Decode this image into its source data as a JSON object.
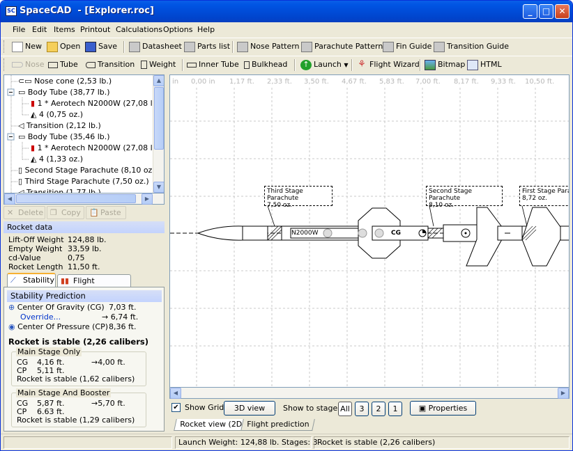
{
  "window": {
    "app": "SpaceCAD",
    "doc": "- [Explorer.roc]",
    "minimize": "_",
    "maximize": "□",
    "close": "✕"
  },
  "menu": [
    "File",
    "Edit",
    "Items",
    "Printout",
    "Calculations",
    "Options",
    "Help"
  ],
  "toolbar1": [
    "New",
    "Open",
    "Save",
    "Datasheet",
    "Parts list",
    "Nose Pattern",
    "Parachute Pattern",
    "Fin Guide",
    "Transition Guide"
  ],
  "toolbar2": [
    "Nose",
    "Tube",
    "Transition",
    "Weight",
    "Inner Tube",
    "Bulkhead",
    "Launch",
    "Flight Wizard",
    "Bitmap",
    "HTML"
  ],
  "tree": [
    "Nose cone (2,53 lb.)",
    "Body Tube (38,77 lb.)",
    "1 * Aerotech N2000W (27,08 lb",
    "4  (0,75 oz.)",
    "Transition (2,12 lb.)",
    "Body Tube (35,46 lb.)",
    "1 * Aerotech N2000W (27,08 lb",
    "4  (1,33 oz.)",
    "Second Stage Parachute (8,10 oz.)",
    "Third Stage Parachute (7,50 oz.)",
    "Transition (1,77 lb.)"
  ],
  "edit": {
    "delete": "Delete",
    "copy": "Copy",
    "paste": "Paste"
  },
  "rocket_data": {
    "header": "Rocket data",
    "rows": [
      {
        "label": "Lift-Off Weight",
        "value": "124,88 lb."
      },
      {
        "label": "Empty Weight",
        "value": "33,59 lb."
      },
      {
        "label": "cd-Value",
        "value": "0,75"
      },
      {
        "label": "Rocket Length",
        "value": "11,50 ft."
      }
    ]
  },
  "left_tabs": [
    "Stability",
    "Flight prediction"
  ],
  "stability": {
    "header": "Stability Prediction",
    "cg_label": "Center Of Gravity (CG)",
    "cg_value": "7,03 ft.",
    "override_label": "Override...",
    "override_value": "→ 6,74 ft.",
    "cp_label": "Center Of Pressure (CP)",
    "cp_value": "8,36 ft.",
    "verdict": "Rocket is stable (2,26 calibers)",
    "main_only": {
      "title": "Main Stage Only",
      "cg_label": "CG",
      "cg": "4,16 ft.",
      "cg_to": "→4,00 ft.",
      "cp_label": "CP",
      "cp": "5,11 ft.",
      "verdict": "Rocket is stable (1,62 calibers)"
    },
    "main_booster": {
      "title": "Main Stage And Booster",
      "cg_label": "CG",
      "cg": "5,87 ft.",
      "cg_to": "→5,70 ft.",
      "cp_label": "CP",
      "cp": "6.63 ft.",
      "verdict": "Rocket is stable (1,29 calibers)"
    }
  },
  "ruler": [
    "in",
    "0,00 in",
    "1,17 ft.",
    "2,33 ft.",
    "3,50 ft.",
    "4,67 ft.",
    "5,83 ft.",
    "7,00 ft.",
    "8,17 ft.",
    "9,33 ft.",
    "10,50 ft."
  ],
  "callouts": [
    {
      "title": "Third Stage Parachute",
      "value": "7,50 oz."
    },
    {
      "title": "Second Stage Parachute",
      "value": "8,10 oz."
    },
    {
      "title": "First Stage Para",
      "value": "8,72 oz."
    }
  ],
  "motor_label": "N2000W",
  "cg_marker": "CG",
  "bottom": {
    "show_grid": "Show Grid",
    "view3d": "3D view",
    "show_to_stage": "Show to stage:",
    "stages": [
      "All",
      "3",
      "2",
      "1"
    ],
    "properties": "Properties"
  },
  "view_tabs": [
    "Rocket view (2D)",
    "Flight prediction"
  ],
  "status": {
    "weight": "Launch Weight: 124,88 lb.",
    "stages": "Stages: 3",
    "stable": "Rocket is stable (2,26 calibers)"
  }
}
